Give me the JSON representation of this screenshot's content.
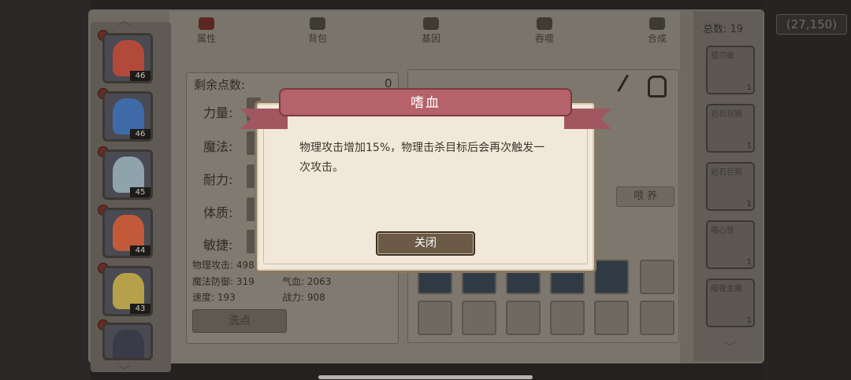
{
  "header": {
    "coins": "(27,150)"
  },
  "tabs": [
    {
      "label": "属性",
      "active": true
    },
    {
      "label": "背包",
      "active": false
    },
    {
      "label": "基因",
      "active": false
    },
    {
      "label": "吞噬",
      "active": false
    },
    {
      "label": "合成",
      "active": false
    }
  ],
  "heroes": [
    {
      "level": "46",
      "color": "#b24a3a"
    },
    {
      "level": "46",
      "color": "#3f6aa8"
    },
    {
      "level": "45",
      "color": "#8fa3ad"
    },
    {
      "level": "44",
      "color": "#c25a3a"
    },
    {
      "level": "43",
      "color": "#b6a04a"
    },
    {
      "level": "",
      "color": "#3a3a48"
    }
  ],
  "attributes": {
    "remaining_label": "剩余点数:",
    "remaining_value": "0",
    "rows": [
      "力量:",
      "魔法:",
      "耐力:",
      "体质:",
      "敏捷:"
    ],
    "stats": {
      "phys_atk": "物理攻击: 498",
      "magic_def": "魔法防御: 319",
      "hp": "气血: 2063",
      "speed": "速度: 193",
      "power": "战力: 908"
    },
    "wash_button": "洗点"
  },
  "equipment": {
    "raise_button": "喂 养"
  },
  "pets": {
    "total_label": "总数: 19",
    "items": [
      {
        "name": "猎刃兽",
        "count": "1"
      },
      {
        "name": "岩石巨狼",
        "count": "1"
      },
      {
        "name": "岩石巨狼",
        "count": "1"
      },
      {
        "name": "噬心怪",
        "count": "1"
      },
      {
        "name": "暗夜金雕",
        "count": "1"
      }
    ]
  },
  "dialog": {
    "title": "嗜血",
    "body": "物理攻击增加15%，物理击杀目标后会再次触发一次攻击。",
    "close_button": "关闭"
  }
}
